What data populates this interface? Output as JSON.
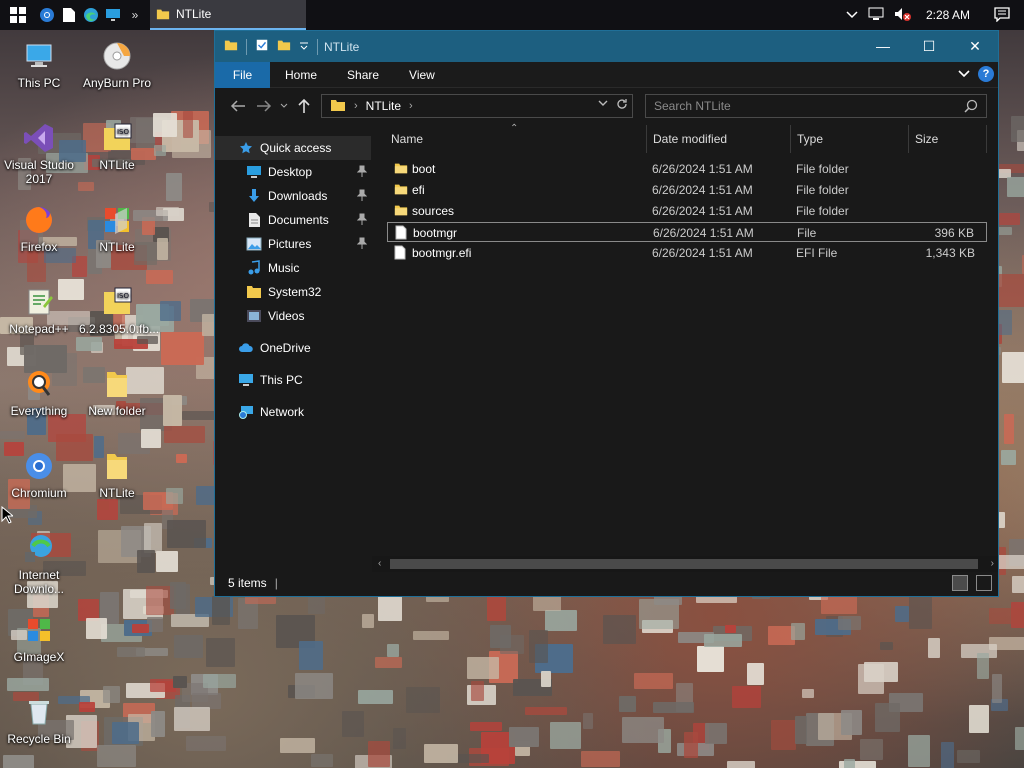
{
  "taskbar": {
    "start_icon": "windows-logo-icon",
    "pinned_icons": [
      "chrome-icon",
      "document-icon",
      "edge-icon",
      "desktop-icon"
    ],
    "overflow_label": "»",
    "active_window": {
      "label": "NTLite",
      "icon": "folder-icon"
    },
    "tray": {
      "icons": [
        "chevron-up-icon",
        "network-icon",
        "volume-muted-icon"
      ],
      "time": "2:28 AM",
      "notification_icon": "action-center-icon"
    }
  },
  "desktop": {
    "icons": [
      {
        "label": "This PC",
        "icon": "computer-icon"
      },
      {
        "label": "AnyBurn Pro",
        "icon": "disc-icon"
      },
      {
        "label": "Visual Studio 2017",
        "icon": "visual-studio-icon"
      },
      {
        "label": "NTLite",
        "icon": "iso-file-icon"
      },
      {
        "label": "Firefox",
        "icon": "firefox-icon"
      },
      {
        "label": "NTLite",
        "icon": "ntlite-app-icon"
      },
      {
        "label": "Notepad++",
        "icon": "notepadpp-icon"
      },
      {
        "label": "6.2.8305.0.fb...",
        "icon": "iso-file-icon"
      },
      {
        "label": "Everything",
        "icon": "search-app-icon"
      },
      {
        "label": "New folder",
        "icon": "folder-icon"
      },
      {
        "label": "Chromium",
        "icon": "chromium-icon"
      },
      {
        "label": "NTLite",
        "icon": "folder-icon"
      },
      {
        "label": "Internet Downlo...",
        "icon": "idm-icon"
      },
      {
        "label": "GImageX",
        "icon": "gimagex-icon"
      },
      {
        "label": "Recycle Bin",
        "icon": "recycle-bin-icon"
      }
    ]
  },
  "explorer": {
    "title": "NTLite",
    "window_controls": {
      "minimize": "—",
      "maximize": "☐",
      "close": "✕"
    },
    "ribbon": {
      "tabs": [
        "File",
        "Home",
        "Share",
        "View"
      ],
      "expand": "⌄",
      "help": "?"
    },
    "address": {
      "crumbs": [
        "NTLite"
      ],
      "separator": "›"
    },
    "search": {
      "placeholder": "Search NTLite"
    },
    "nav_pane": {
      "quick_access": "Quick access",
      "items": [
        {
          "label": "Desktop",
          "icon": "desktop-icon",
          "pinned": true
        },
        {
          "label": "Downloads",
          "icon": "downloads-icon",
          "pinned": true
        },
        {
          "label": "Documents",
          "icon": "documents-icon",
          "pinned": true
        },
        {
          "label": "Pictures",
          "icon": "pictures-icon",
          "pinned": true
        },
        {
          "label": "Music",
          "icon": "music-icon",
          "pinned": false
        },
        {
          "label": "System32",
          "icon": "folder-icon",
          "pinned": false
        },
        {
          "label": "Videos",
          "icon": "videos-icon",
          "pinned": false
        }
      ],
      "onedrive": "OneDrive",
      "this_pc": "This PC",
      "network": "Network"
    },
    "columns": [
      "Name",
      "Date modified",
      "Type",
      "Size"
    ],
    "files": [
      {
        "name": "boot",
        "date": "6/26/2024 1:51 AM",
        "type": "File folder",
        "size": "",
        "kind": "folder"
      },
      {
        "name": "efi",
        "date": "6/26/2024 1:51 AM",
        "type": "File folder",
        "size": "",
        "kind": "folder"
      },
      {
        "name": "sources",
        "date": "6/26/2024 1:51 AM",
        "type": "File folder",
        "size": "",
        "kind": "folder"
      },
      {
        "name": "bootmgr",
        "date": "6/26/2024 1:51 AM",
        "type": "File",
        "size": "396 KB",
        "kind": "file"
      },
      {
        "name": "bootmgr.efi",
        "date": "6/26/2024 1:51 AM",
        "type": "EFI File",
        "size": "1,343 KB",
        "kind": "file"
      }
    ],
    "status": {
      "items": "5 items",
      "divider": "|"
    }
  },
  "colors": {
    "titlebar": "#1d5f80",
    "file_tab": "#1a6aa8",
    "folder_yellow": "#f2c94c",
    "window_bg": "#191919"
  }
}
